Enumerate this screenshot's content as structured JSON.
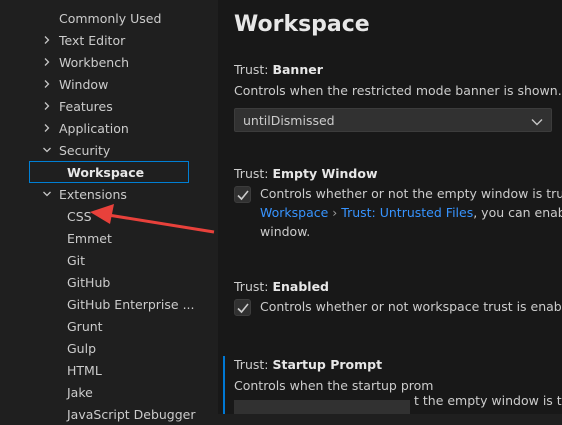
{
  "tree": {
    "items": [
      {
        "label": "Commonly Used",
        "chevron": "none",
        "indent": 1
      },
      {
        "label": "Text Editor",
        "chevron": "right",
        "indent": 1
      },
      {
        "label": "Workbench",
        "chevron": "right",
        "indent": 1
      },
      {
        "label": "Window",
        "chevron": "right",
        "indent": 1
      },
      {
        "label": "Features",
        "chevron": "right",
        "indent": 1
      },
      {
        "label": "Application",
        "chevron": "right",
        "indent": 1
      },
      {
        "label": "Security",
        "chevron": "down",
        "indent": 1
      },
      {
        "label": "Workspace",
        "chevron": "none",
        "indent": 2,
        "selected": true
      },
      {
        "label": "Extensions",
        "chevron": "down",
        "indent": 1
      },
      {
        "label": "CSS",
        "chevron": "none",
        "indent": 2
      },
      {
        "label": "Emmet",
        "chevron": "none",
        "indent": 2
      },
      {
        "label": "Git",
        "chevron": "none",
        "indent": 2
      },
      {
        "label": "GitHub",
        "chevron": "none",
        "indent": 2
      },
      {
        "label": "GitHub Enterprise ...",
        "chevron": "none",
        "indent": 2
      },
      {
        "label": "Grunt",
        "chevron": "none",
        "indent": 2
      },
      {
        "label": "Gulp",
        "chevron": "none",
        "indent": 2
      },
      {
        "label": "HTML",
        "chevron": "none",
        "indent": 2
      },
      {
        "label": "Jake",
        "chevron": "none",
        "indent": 2
      },
      {
        "label": "JavaScript Debugger",
        "chevron": "none",
        "indent": 2
      }
    ]
  },
  "main": {
    "title": "Workspace",
    "banner": {
      "prefix": "Trust: ",
      "name": "Banner",
      "description": "Controls when the restricted mode banner is shown.",
      "value": "untilDismissed"
    },
    "empty_window": {
      "prefix": "Trust: ",
      "name": "Empty Window",
      "line1": "Controls whether or not the empty window is trusted",
      "link1": "Workspace",
      "sep": " › ",
      "link2": "Trust: Untrusted Files",
      "line2_rest": ", you can enable th",
      "line3": "window.",
      "checked": true
    },
    "enabled": {
      "prefix": "Trust: ",
      "name": "Enabled",
      "line1": "Controls whether or not workspace trust is enabled w",
      "checked": true
    },
    "startup_prompt": {
      "prefix": "Trust: ",
      "name": "Startup Prompt",
      "description": "Controls when the startup prom",
      "overlay": "t the empty window is trus"
    }
  },
  "colors": {
    "accent": "#007fd4",
    "link": "#3794ff",
    "annotation_arrow": "#e8413b"
  }
}
